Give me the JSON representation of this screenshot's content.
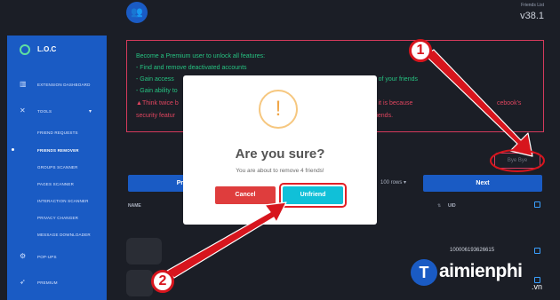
{
  "sidebar": {
    "brand": "L.O.C",
    "items": [
      {
        "label": "EXTENSION DASHBOARD",
        "icon": "bank-icon"
      },
      {
        "label": "TOOLS",
        "icon": "tools-icon"
      },
      {
        "label": "FRIEND REQUESTS"
      },
      {
        "label": "FRIENDS REMOVER"
      },
      {
        "label": "GROUPS SCANNER"
      },
      {
        "label": "PAGES SCANNER"
      },
      {
        "label": "INTERACTION SCANNER"
      },
      {
        "label": "PRIVACY CHANGER"
      },
      {
        "label": "MESSAGE DOWNLOADER"
      },
      {
        "label": "POP-UPS",
        "icon": "gear-icon"
      },
      {
        "label": "PREMIUM",
        "icon": "rocket-icon"
      }
    ]
  },
  "header": {
    "friends_list_label": "Friends List",
    "version": "v38.1"
  },
  "premium_notice": {
    "line1": "Become a Premium user to unlock all features:",
    "line2": "- Find and remove deactivated accounts",
    "line3a": "- Gain access",
    "line3b": "status of your friends",
    "line4": "- Gain ability to",
    "line5a": "Think twice b",
    "line5b": "this feature, it is because",
    "line5c": "cebook's",
    "line6a": "security featur",
    "line6b": "riends."
  },
  "badge": "Bye Bye",
  "controls": {
    "prev_label": "Pre",
    "rows_label": "100 rows",
    "next_label": "Next"
  },
  "table": {
    "col_name": "NAME",
    "col_uid": "UID",
    "uid_value": "100006193626615"
  },
  "modal": {
    "icon": "!",
    "title": "Are you sure?",
    "text": "You are about to remove 4 friends!",
    "cancel_label": "Cancel",
    "unfriend_label": "Unfriend"
  },
  "callouts": {
    "one": "1",
    "two": "2"
  },
  "watermark": {
    "logo": "T",
    "name": "aimienphi",
    "suffix": ".vn"
  },
  "colors": {
    "sidebar": "#1a5bc4",
    "accent_cyan": "#10c0d8",
    "danger": "#df3d3d",
    "annotation_red": "#d7151d"
  }
}
